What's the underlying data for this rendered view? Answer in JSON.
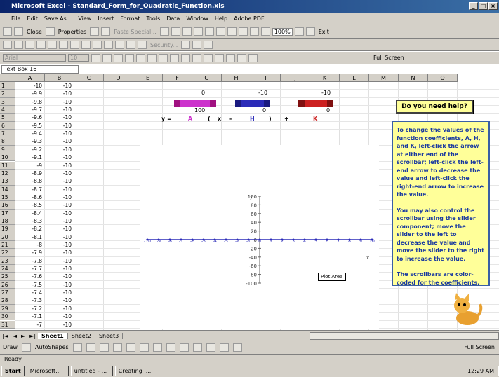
{
  "window": {
    "title": "Microsoft Excel - Standard_Form_for_Quadratic_Function.xls"
  },
  "menu": [
    "File",
    "Edit",
    "Save As...",
    "View",
    "Insert",
    "Format",
    "Tools",
    "Data",
    "Window",
    "Help",
    "Adobe PDF"
  ],
  "toolbar1": {
    "close": "Close",
    "properties": "Properties",
    "paste_special": "Paste Special...",
    "zoom": "100%",
    "exit": "Exit"
  },
  "toolbar2": {
    "security": "Security..."
  },
  "toolbar3": {
    "font": "Arial",
    "size": "10",
    "fullscreen": "Full Screen"
  },
  "namebox": "Text Box 16",
  "columns": [
    "A",
    "B",
    "C",
    "D",
    "E",
    "F",
    "G",
    "H",
    "I",
    "J",
    "K",
    "L",
    "M",
    "N",
    "O"
  ],
  "rows": [
    {
      "n": "1",
      "a": "-10",
      "b": "-10"
    },
    {
      "n": "2",
      "a": "-9.9",
      "b": "-10"
    },
    {
      "n": "3",
      "a": "-9.8",
      "b": "-10"
    },
    {
      "n": "4",
      "a": "-9.7",
      "b": "-10"
    },
    {
      "n": "5",
      "a": "-9.6",
      "b": "-10"
    },
    {
      "n": "6",
      "a": "-9.5",
      "b": "-10"
    },
    {
      "n": "7",
      "a": "-9.4",
      "b": "-10"
    },
    {
      "n": "8",
      "a": "-9.3",
      "b": "-10"
    },
    {
      "n": "9",
      "a": "-9.2",
      "b": "-10"
    },
    {
      "n": "10",
      "a": "-9.1",
      "b": "-10"
    },
    {
      "n": "11",
      "a": "-9",
      "b": "-10"
    },
    {
      "n": "12",
      "a": "-8.9",
      "b": "-10"
    },
    {
      "n": "13",
      "a": "-8.8",
      "b": "-10"
    },
    {
      "n": "14",
      "a": "-8.7",
      "b": "-10"
    },
    {
      "n": "15",
      "a": "-8.6",
      "b": "-10"
    },
    {
      "n": "16",
      "a": "-8.5",
      "b": "-10"
    },
    {
      "n": "17",
      "a": "-8.4",
      "b": "-10"
    },
    {
      "n": "18",
      "a": "-8.3",
      "b": "-10"
    },
    {
      "n": "19",
      "a": "-8.2",
      "b": "-10"
    },
    {
      "n": "20",
      "a": "-8.1",
      "b": "-10"
    },
    {
      "n": "21",
      "a": "-8",
      "b": "-10"
    },
    {
      "n": "22",
      "a": "-7.9",
      "b": "-10"
    },
    {
      "n": "23",
      "a": "-7.8",
      "b": "-10"
    },
    {
      "n": "24",
      "a": "-7.7",
      "b": "-10"
    },
    {
      "n": "25",
      "a": "-7.6",
      "b": "-10"
    },
    {
      "n": "26",
      "a": "-7.5",
      "b": "-10"
    },
    {
      "n": "27",
      "a": "-7.4",
      "b": "-10"
    },
    {
      "n": "28",
      "a": "-7.3",
      "b": "-10"
    },
    {
      "n": "29",
      "a": "-7.2",
      "b": "-10"
    },
    {
      "n": "30",
      "a": "-7.1",
      "b": "-10"
    },
    {
      "n": "31",
      "a": "-7",
      "b": "-10"
    }
  ],
  "controls": {
    "a_top": "0",
    "h_top": "-10",
    "k_top": "-10",
    "a_val": "100",
    "h_val": "0",
    "k_val": "0",
    "eq_y": "y =",
    "eq_a": "A",
    "eq_paren": "(",
    "eq_x": "x",
    "eq_minus": "-",
    "eq_h": "H",
    "eq_close": ")",
    "eq_plus": "+",
    "eq_k": "K"
  },
  "help": {
    "button": "Do you need help?",
    "p1": "To change the values of the function coefficients, A, H, and K, left-click the arrow at either end of the scrollbar; left-click the left-end arrow to decrease the value and left-click the right-end arrow to increase the value.",
    "p2": "You may also control the scrollbar using the slider component; move the slider to the left to decrease the value and move the slider to the right to increase the value.",
    "p3": "The scrollbars are color-coded for the coefficients."
  },
  "colors": {
    "a_bar": "#cc33cc",
    "h_bar": "#2b2bb8",
    "k_bar": "#cc2020",
    "help_bg": "#ffff99",
    "help_text": "#1a3aa0"
  },
  "chart_data": {
    "type": "line",
    "x_ticks": [
      "-10",
      "-9",
      "-8",
      "-7",
      "-6",
      "-5",
      "-4",
      "-3",
      "-2",
      "-1",
      "0",
      "1",
      "2",
      "3",
      "4",
      "5",
      "6",
      "7",
      "8",
      "9",
      "10"
    ],
    "y_ticks": [
      "100",
      "80",
      "60",
      "40",
      "20",
      "0",
      "-20",
      "-40",
      "-60",
      "-80",
      "-100"
    ],
    "xlim": [
      -10,
      10
    ],
    "ylim": [
      -100,
      100
    ],
    "x": [
      -10,
      -9,
      -8,
      -7,
      -6,
      -5,
      -4,
      -3,
      -2,
      -1,
      0,
      1,
      2,
      3,
      4,
      5,
      6,
      7,
      8,
      9,
      10
    ],
    "y": [
      0,
      0,
      0,
      0,
      0,
      0,
      0,
      0,
      0,
      0,
      0,
      0,
      0,
      0,
      0,
      0,
      0,
      0,
      0,
      0,
      0
    ],
    "ylabel": "y",
    "xlabel": "x",
    "plot_area_label": "Plot Area"
  },
  "sheets": [
    "Sheet1",
    "Sheet2",
    "Sheet3"
  ],
  "drawbar": {
    "draw": "Draw",
    "autoshapes": "AutoShapes",
    "fullscreen": "Full Screen"
  },
  "status": "Ready",
  "taskbar": {
    "start": "Start",
    "items": [
      "Microsoft...",
      "untitled - ...",
      "Creating I..."
    ],
    "time": "12:29 AM"
  }
}
